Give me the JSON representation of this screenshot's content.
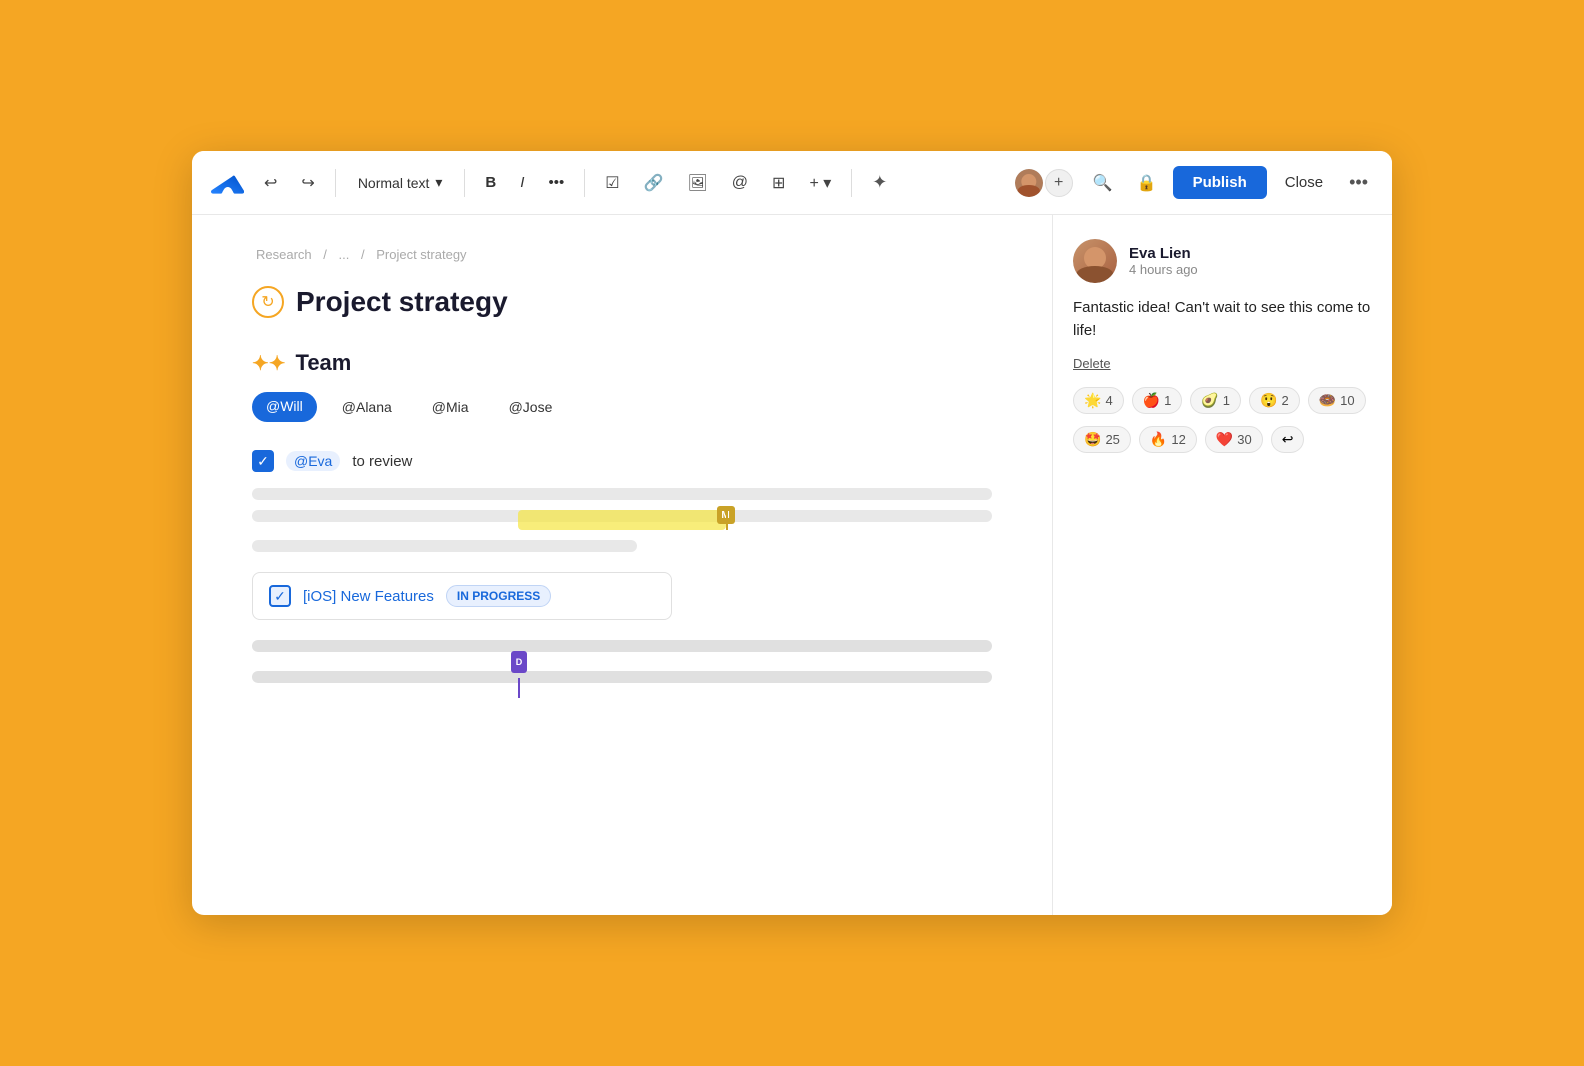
{
  "toolbar": {
    "normal_text_label": "Normal text",
    "normal_text_chevron": "▾",
    "bold_label": "B",
    "italic_label": "I",
    "more_label": "•••",
    "publish_label": "Publish",
    "close_label": "Close"
  },
  "breadcrumb": {
    "parts": [
      "Research",
      "/",
      "...",
      "/",
      "Project strategy"
    ]
  },
  "page": {
    "title": "Project strategy",
    "section_heading": "Team",
    "team_members": [
      {
        "label": "@Will",
        "style": "highlight"
      },
      {
        "label": "@Alana",
        "style": "outline"
      },
      {
        "label": "@Mia",
        "style": "outline"
      },
      {
        "label": "@Jose",
        "style": "outline"
      }
    ],
    "task_mention": "@Eva",
    "task_text": "to review",
    "ios_task_label": "[iOS] New Features",
    "ios_status": "IN PROGRESS"
  },
  "comment": {
    "author": "Eva Lien",
    "time": "4 hours ago",
    "text": "Fantastic idea! Can't wait to see this come to life!",
    "delete_label": "Delete",
    "reactions": [
      {
        "emoji": "🌟",
        "count": "4"
      },
      {
        "emoji": "🍎",
        "count": "1"
      },
      {
        "emoji": "🥑",
        "count": "1"
      },
      {
        "emoji": "😲",
        "count": "2"
      },
      {
        "emoji": "🍩",
        "count": "10"
      }
    ],
    "reactions_row2": [
      {
        "emoji": "🤩",
        "count": "25"
      },
      {
        "emoji": "🔥",
        "count": "12"
      },
      {
        "emoji": "❤️",
        "count": "30"
      },
      {
        "emoji": "↩",
        "count": ""
      }
    ]
  },
  "cursor": {
    "marker_m": "M",
    "marker_d": "D"
  }
}
